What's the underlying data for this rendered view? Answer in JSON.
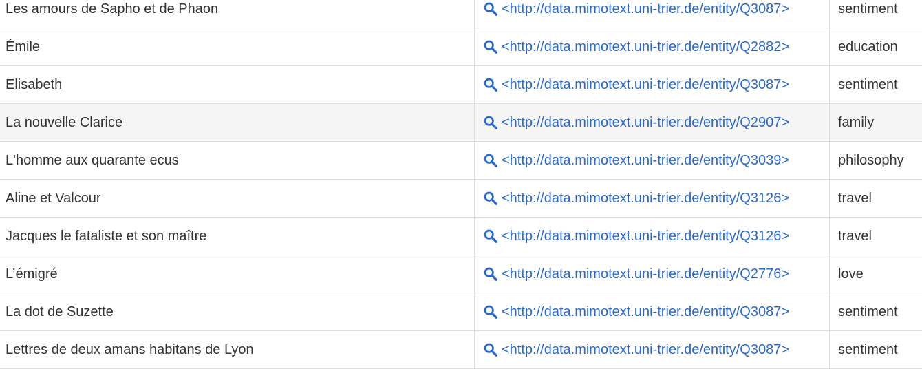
{
  "colors": {
    "link": "#2a6ad0",
    "text": "#333333",
    "border": "#dddddd",
    "highlight_row": "#f5f5f5"
  },
  "icons": {
    "entity_lookup": "search-icon"
  },
  "rows": [
    {
      "title": "Les amours de Sapho et de Phaon",
      "entity": "<http://data.mimotext.uni-trier.de/entity/Q3087>",
      "theme": "sentiment"
    },
    {
      "title": "Émile",
      "entity": "<http://data.mimotext.uni-trier.de/entity/Q2882>",
      "theme": "education"
    },
    {
      "title": "Elisabeth",
      "entity": "<http://data.mimotext.uni-trier.de/entity/Q3087>",
      "theme": "sentiment"
    },
    {
      "title": "La nouvelle Clarice",
      "entity": "<http://data.mimotext.uni-trier.de/entity/Q2907>",
      "theme": "family"
    },
    {
      "title": "L'homme aux quarante ecus",
      "entity": "<http://data.mimotext.uni-trier.de/entity/Q3039>",
      "theme": "philosophy"
    },
    {
      "title": "Aline et Valcour",
      "entity": "<http://data.mimotext.uni-trier.de/entity/Q3126>",
      "theme": "travel"
    },
    {
      "title": "Jacques le fataliste et son maître",
      "entity": "<http://data.mimotext.uni-trier.de/entity/Q3126>",
      "theme": "travel"
    },
    {
      "title": "L’émigré",
      "entity": "<http://data.mimotext.uni-trier.de/entity/Q2776>",
      "theme": "love"
    },
    {
      "title": "La dot de Suzette",
      "entity": "<http://data.mimotext.uni-trier.de/entity/Q3087>",
      "theme": "sentiment"
    },
    {
      "title": "Lettres de deux amans habitans de Lyon",
      "entity": "<http://data.mimotext.uni-trier.de/entity/Q3087>",
      "theme": "sentiment"
    }
  ]
}
